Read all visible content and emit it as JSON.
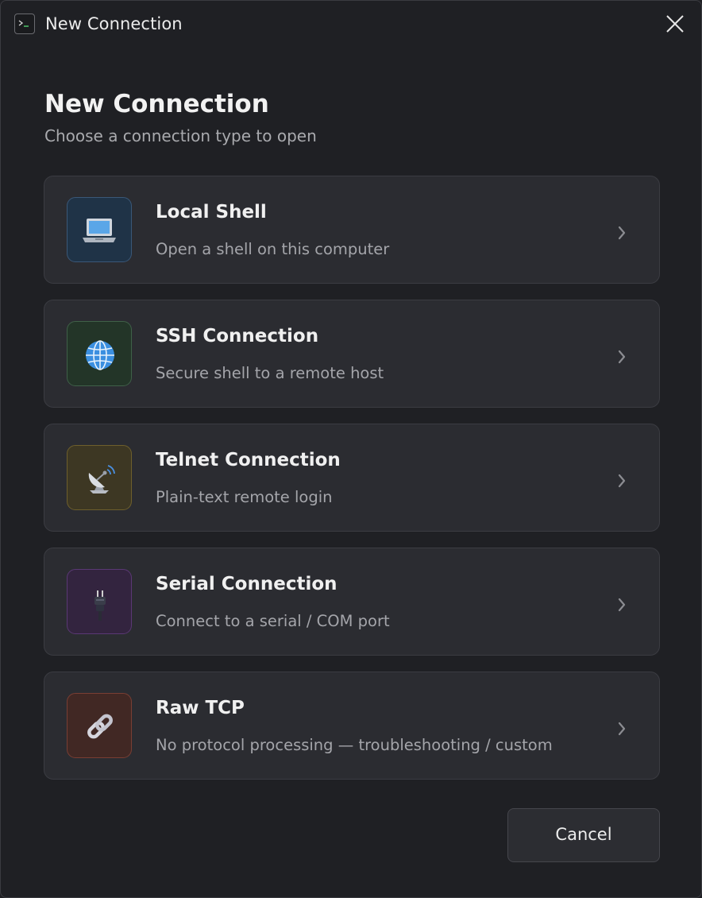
{
  "window": {
    "title": "New Connection",
    "app_icon": "terminal-icon",
    "close_icon": "close-icon"
  },
  "header": {
    "title": "New Connection",
    "subtitle": "Choose a connection type to open"
  },
  "options": [
    {
      "title": "Local Shell",
      "description": "Open a shell on this computer",
      "icon": "laptop-icon",
      "icon_bg": "#1f3347",
      "icon_border": "#3a5878"
    },
    {
      "title": "SSH Connection",
      "description": "Secure shell to a remote host",
      "icon": "globe-icon",
      "icon_bg": "#233528",
      "icon_border": "#3f6048"
    },
    {
      "title": "Telnet Connection",
      "description": "Plain-text remote login",
      "icon": "satellite-dish-icon",
      "icon_bg": "#3d3723",
      "icon_border": "#6e5f2c"
    },
    {
      "title": "Serial Connection",
      "description": "Connect to a serial / COM port",
      "icon": "plug-icon",
      "icon_bg": "#33243f",
      "icon_border": "#5a3874"
    },
    {
      "title": "Raw TCP",
      "description": "No protocol processing — troubleshooting / custom",
      "icon": "link-icon",
      "icon_bg": "#412824",
      "icon_border": "#7a3e33"
    }
  ],
  "footer": {
    "cancel_label": "Cancel"
  },
  "colors": {
    "background": "#1f2024",
    "card": "#2b2c31",
    "card_border": "#3b3c42",
    "text_primary": "#f0f0f0",
    "text_secondary": "#a4a5aa"
  }
}
